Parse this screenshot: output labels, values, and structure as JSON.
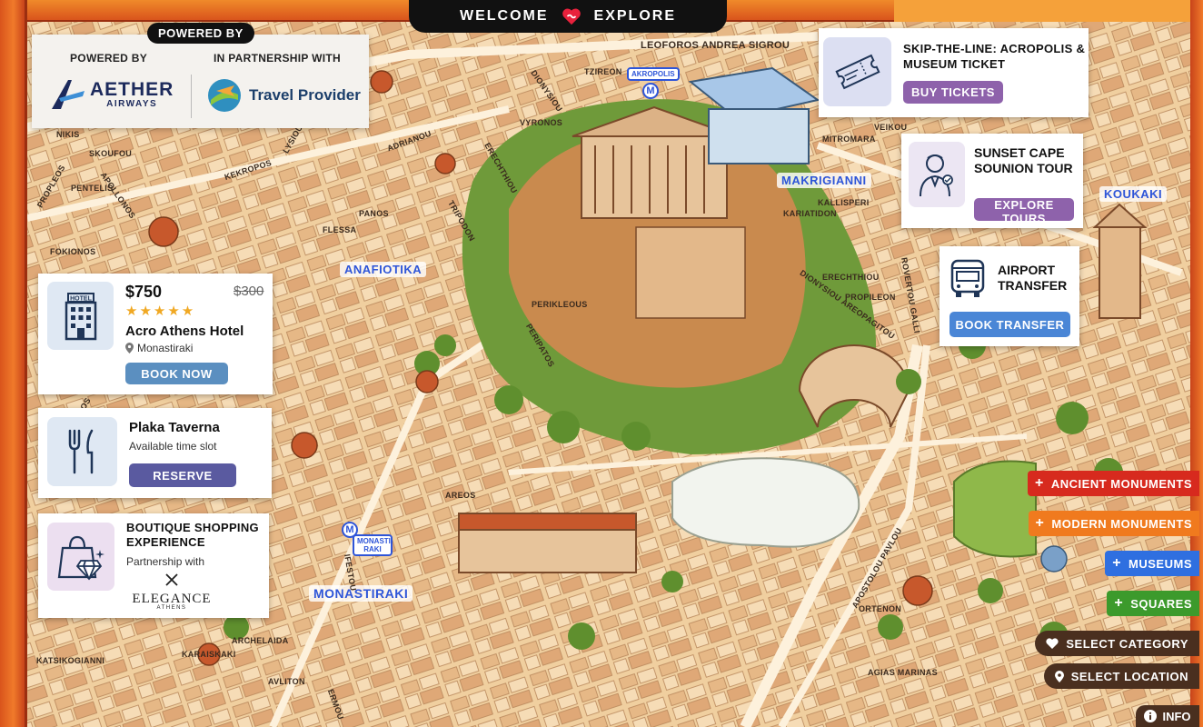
{
  "topbar": {
    "welcome": "WELCOME",
    "explore": "EXPLORE"
  },
  "sponsor": {
    "pill": "POWERED BY",
    "powered_by": "POWERED BY",
    "partnership": "IN PARTNERSHIP WITH",
    "airline_name": "AETHER",
    "airline_sub": "AIRWAYS",
    "provider_name": "Travel Provider"
  },
  "hotel": {
    "price": "$750",
    "old_price": "$300",
    "stars": "★★★★★",
    "name": "Acro Athens Hotel",
    "location": "Monastiraki",
    "button": "BOOK NOW",
    "icon_label": "HOTEL"
  },
  "taverna": {
    "name": "Plaka Taverna",
    "sub": "Available time slot",
    "button": "RESERVE"
  },
  "boutique": {
    "title_line1": "BOUTIQUE SHOPPING",
    "title_line2": "EXPERIENCE",
    "sub": "Partnership with",
    "brand": "ELEGANCE",
    "brand_sub": "ATHENS"
  },
  "acropolis_ticket": {
    "title_line1": "SKIP-THE-LINE: ACROPOLIS &",
    "title_line2": "MUSEUM TICKET",
    "button": "BUY TICKETS"
  },
  "sounion": {
    "title_line1": "SUNSET CAPE",
    "title_line2": "SOUNION TOUR",
    "button": "EXPLORE TOURS"
  },
  "airport": {
    "title_line1": "AIRPORT",
    "title_line2": "TRANSFER",
    "button": "BOOK TRANSFER"
  },
  "categories": [
    {
      "label": "ANCIENT MONUMENTS",
      "color": "#d72a1e"
    },
    {
      "label": "MODERN MONUMENTS",
      "color": "#f07a1e"
    },
    {
      "label": "MUSEUMS",
      "color": "#2f6fe0"
    },
    {
      "label": "SQUARES",
      "color": "#3c9a2c"
    }
  ],
  "select_category": "SELECT CATEGORY",
  "select_location": "SELECT LOCATION",
  "info": "INFO",
  "map": {
    "districts": [
      "ANAFIOTIKA",
      "MAKRIGIANNI",
      "KOUKAKI",
      "MONASTIRAKI"
    ],
    "metro_acropolis": "AKROPOLIS",
    "metro_monastiraki_1": "MONASTI-",
    "metro_monastiraki_2": "RAKI",
    "metro_symbol": "M",
    "streets": [
      "LEOFOROS ANDREA SIGROU",
      "ADRIANOU",
      "APOLLONOS",
      "KEKROPOS",
      "VYRONOS",
      "DIONYSIOU AREOPAGITOU",
      "MITROMARA",
      "VEIKOU",
      "ROVERTOU GALLI",
      "APOSTOLOU PAVLOU",
      "AREOS",
      "IFESTOU",
      "ERMOU",
      "ASTIGGOS",
      "PERIKLEOUS",
      "FLESSA",
      "ARCHELAIDA",
      "KARAISKAKI",
      "KATSIKOGIANNI",
      "AVLITON",
      "AGIAS MARINAS",
      "ORTENON",
      "NIKIS",
      "FOKIONOS",
      "PERIPATOS",
      "PROPLEOS",
      "SKOUFOU",
      "PENTELIS",
      "LYSIOU",
      "KARIATIDON",
      "ERECHTHIOU",
      "PROPILEON",
      "PANOS",
      "TZIREON",
      "DIONYSIOU",
      "TRIPODON",
      "ERECHTHIOU",
      "KALLISPERI"
    ]
  }
}
